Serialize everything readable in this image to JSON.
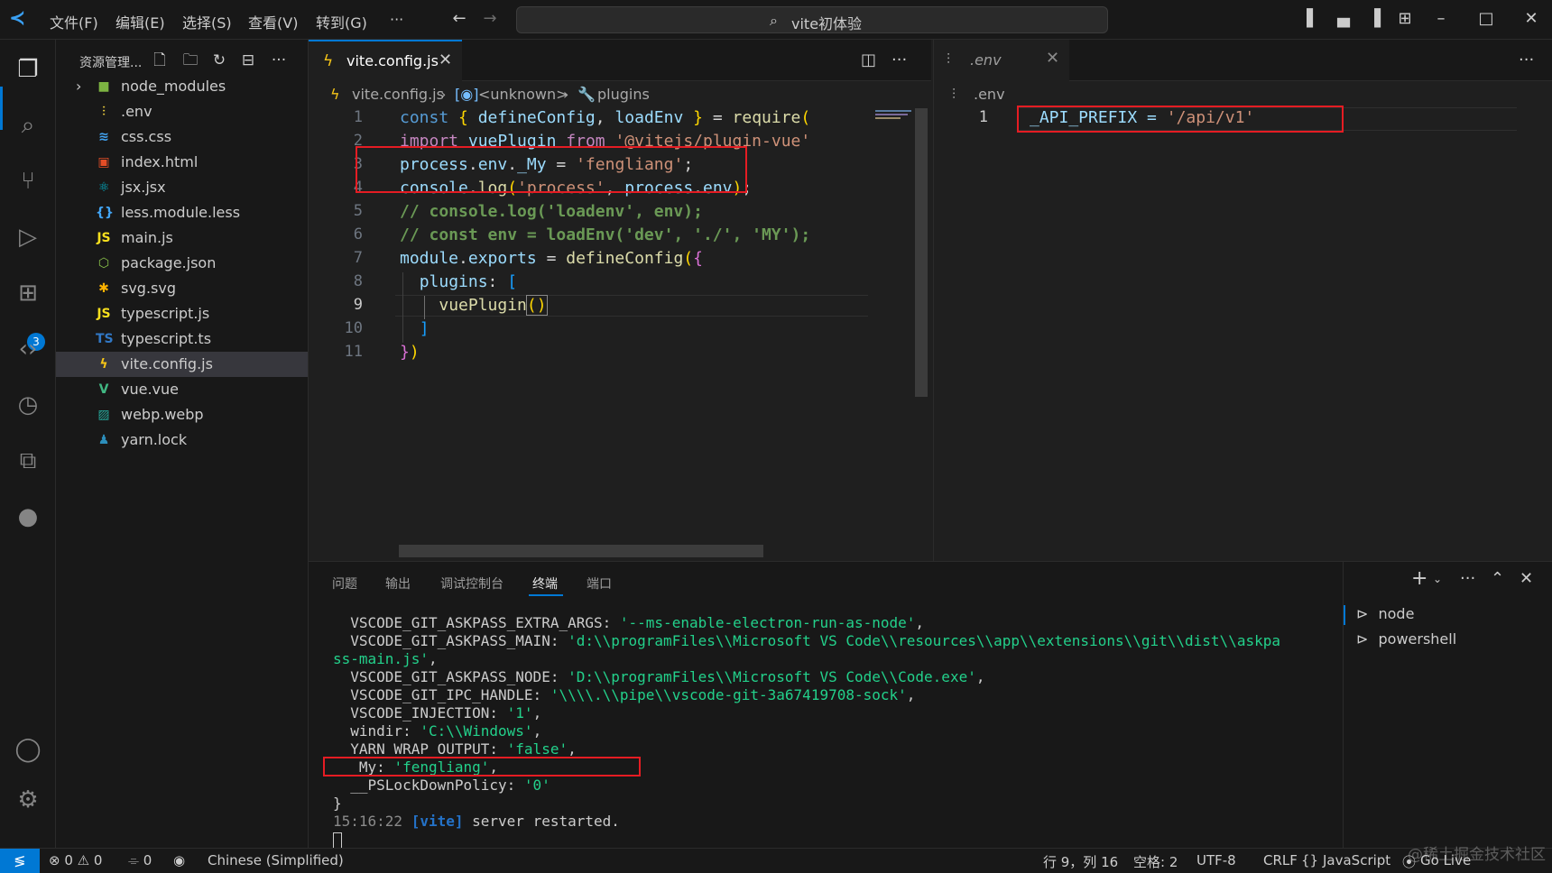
{
  "titlebar": {
    "menus": [
      "文件(F)",
      "编辑(E)",
      "选择(S)",
      "查看(V)",
      "转到(G)",
      "···"
    ],
    "search_text": "vite初体验"
  },
  "activitybar": {
    "extensions_badge": "3"
  },
  "sidebar": {
    "title": "资源管理...",
    "files": [
      {
        "name": "node_modules",
        "icon": "folder-icon"
      },
      {
        "name": ".env",
        "icon": "env-icon"
      },
      {
        "name": "css.css",
        "icon": "css-icon"
      },
      {
        "name": "index.html",
        "icon": "html-icon"
      },
      {
        "name": "jsx.jsx",
        "icon": "react-icon"
      },
      {
        "name": "less.module.less",
        "icon": "braces-icon"
      },
      {
        "name": "main.js",
        "icon": "js-icon"
      },
      {
        "name": "package.json",
        "icon": "npm-icon"
      },
      {
        "name": "svg.svg",
        "icon": "svg-icon"
      },
      {
        "name": "typescript.js",
        "icon": "js-icon"
      },
      {
        "name": "typescript.ts",
        "icon": "ts-icon"
      },
      {
        "name": "vite.config.js",
        "icon": "vite-icon"
      },
      {
        "name": "vue.vue",
        "icon": "vue-icon"
      },
      {
        "name": "webp.webp",
        "icon": "image-icon"
      },
      {
        "name": "yarn.lock",
        "icon": "yarn-icon"
      }
    ]
  },
  "editor1": {
    "tab_label": "vite.config.js",
    "breadcrumb": [
      "vite.config.js",
      "<unknown>",
      "plugins"
    ],
    "line_numbers": [
      "1",
      "2",
      "3",
      "4",
      "5",
      "6",
      "7",
      "8",
      "9",
      "10",
      "11"
    ],
    "lines": [
      "const { defineConfig, loadEnv } = require(",
      "import vuePlugin from '@vitejs/plugin-vue'",
      "process.env._My = 'fengliang';",
      "console.log('process', process.env);",
      "// console.log('loadenv', env);",
      "// const env = loadEnv('dev', './', 'MY');",
      "module.exports = defineConfig({",
      "  plugins: [",
      "    vuePlugin()",
      "  ]",
      "})"
    ]
  },
  "editor2": {
    "tab_label": ".env",
    "breadcrumb": ".env",
    "line_number": "1",
    "line": "_API_PREFIX = '/api/v1'"
  },
  "panel": {
    "tabs": [
      "问题",
      "输出",
      "调试控制台",
      "终端",
      "端口"
    ],
    "terminal_lines": [
      "  VSCODE_GIT_ASKPASS_EXTRA_ARGS: '--ms-enable-electron-run-as-node',",
      "  VSCODE_GIT_ASKPASS_MAIN: 'd:\\\\programFiles\\\\Microsoft VS Code\\\\resources\\\\app\\\\extensions\\\\git\\\\dist\\\\askpa",
      "ss-main.js',",
      "  VSCODE_GIT_ASKPASS_NODE: 'D:\\\\programFiles\\\\Microsoft VS Code\\\\Code.exe',",
      "  VSCODE_GIT_IPC_HANDLE: '\\\\\\\\.\\\\pipe\\\\vscode-git-3a67419708-sock',",
      "  VSCODE_INJECTION: '1',",
      "  windir: 'C:\\\\Windows',",
      "  YARN_WRAP_OUTPUT: 'false',",
      "  _My: 'fengliang',",
      "  __PSLockDownPolicy: '0'",
      "}"
    ],
    "restart_time": "15:16:22",
    "restart_tag": "[vite]",
    "restart_msg": "server restarted.",
    "terminals": [
      "node",
      "powershell"
    ]
  },
  "statusbar": {
    "errors": "0",
    "warnings": "0",
    "ports": "0",
    "language_pack": "Chinese (Simplified)",
    "position": "行 9，列 16",
    "spaces": "空格: 2",
    "encoding": "UTF-8",
    "eol": "CRLF",
    "language": "JavaScript",
    "golive": "Go Live",
    "watermark": "@稀土掘金技术社区"
  },
  "colors": {
    "accent": "#0078d4",
    "highlight_box": "#e51c23"
  }
}
